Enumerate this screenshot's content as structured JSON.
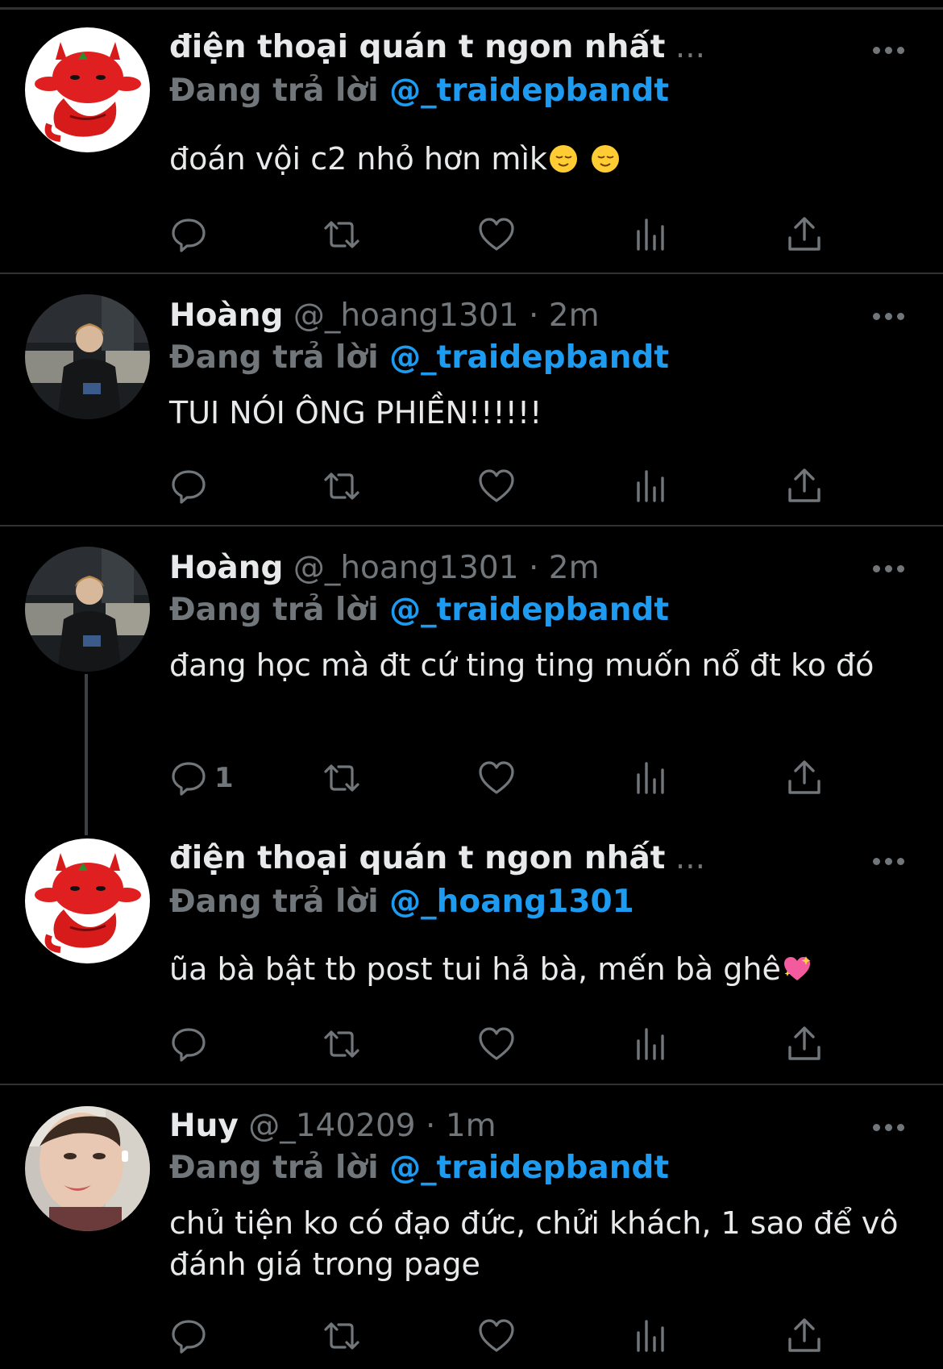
{
  "reply_prefix": "Đang trả lời",
  "tweets": [
    {
      "name": "điện thoại quán t ngon nhất",
      "ellipsis": "...",
      "handle": "",
      "time": "",
      "reply_to": "@_traidepbandt",
      "text": "đoán vội c2 nhỏ hơn mìk",
      "reply_count": "",
      "avatar": "red-devil-cartoon"
    },
    {
      "name": "Hoàng",
      "ellipsis": "",
      "handle": "@_hoang1301",
      "time": "2m",
      "reply_to": "@_traidepbandt",
      "text": "TUI NÓI ÔNG PHIỀN!!!!!!",
      "reply_count": "",
      "avatar": "photo-person-dark-jacket"
    },
    {
      "name": "Hoàng",
      "ellipsis": "",
      "handle": "@_hoang1301",
      "time": "2m",
      "reply_to": "@_traidepbandt",
      "text": "đang học mà đt cứ ting ting muốn nổ đt ko đó",
      "reply_count": "1",
      "avatar": "photo-person-dark-jacket"
    },
    {
      "name": "điện thoại quán t ngon nhất",
      "ellipsis": "...",
      "handle": "",
      "time": "",
      "reply_to": "@_hoang1301",
      "text": "ũa bà bật tb post tui hả bà, mến bà ghê",
      "reply_count": "",
      "avatar": "red-devil-cartoon"
    },
    {
      "name": "Huy",
      "ellipsis": "",
      "handle": "@_140209",
      "time": "1m",
      "reply_to": "@_traidepbandt",
      "text": "chủ tiện ko có đạo đức, chửi khách, 1 sao để vô đánh giá trong page",
      "reply_count": "",
      "avatar": "photo-person-closeup"
    }
  ],
  "colors": {
    "background": "#000000",
    "text": "#e7e9ea",
    "muted": "#71767b",
    "link": "#1d9bf0",
    "divider": "#2f3336"
  },
  "icons": [
    "reply-icon",
    "retweet-icon",
    "like-icon",
    "analytics-icon",
    "share-icon",
    "more-icon"
  ]
}
